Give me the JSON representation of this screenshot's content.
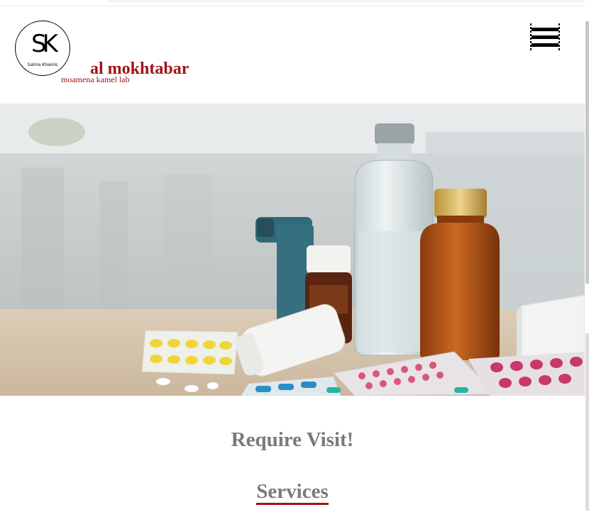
{
  "header": {
    "logo": {
      "monogram": "SK",
      "signature": "Salma Khamis"
    },
    "brand_title": "al mokhtabar",
    "brand_subtitle": "moamena kamel lab",
    "menu_icon": "hamburger-menu-icon"
  },
  "hero": {
    "image_subject": "medicine bottles, inhaler and pill blister packs on a table"
  },
  "main": {
    "heading": "Require Visit!",
    "services_link": "Services"
  },
  "colors": {
    "brand": "#a01515",
    "heading_gray": "#7a7a7a",
    "background": "#ffffff"
  }
}
